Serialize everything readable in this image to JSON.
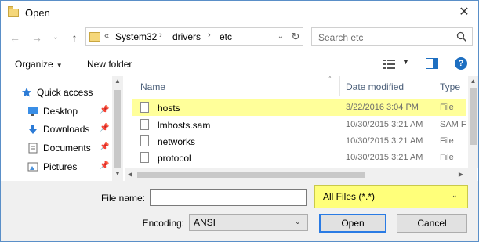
{
  "window": {
    "title": "Open",
    "close_glyph": "✕"
  },
  "nav": {
    "back_glyph": "←",
    "forward_glyph": "→",
    "recent_glyph": "⌄",
    "up_glyph": "↑",
    "breadcrumb_prefix": "«",
    "breadcrumbs": [
      "System32",
      "drivers",
      "etc"
    ],
    "crumb_sep": "›",
    "dropdown_glyph": "⌄",
    "refresh_glyph": "↻"
  },
  "search": {
    "placeholder": "Search etc"
  },
  "toolbar": {
    "organize_label": "Organize",
    "new_folder_label": "New folder",
    "arrow": "▼",
    "help_label": "?"
  },
  "sidebar": {
    "items": [
      {
        "label": "Quick access",
        "icon": "star-icon",
        "pinned": false
      },
      {
        "label": "Desktop",
        "icon": "desktop-icon",
        "pinned": true
      },
      {
        "label": "Downloads",
        "icon": "downloads-icon",
        "pinned": true
      },
      {
        "label": "Documents",
        "icon": "documents-icon",
        "pinned": true
      },
      {
        "label": "Pictures",
        "icon": "pictures-icon",
        "pinned": true
      }
    ],
    "pin_glyph": "📌"
  },
  "columns": {
    "name": "Name",
    "date": "Date modified",
    "type": "Type",
    "sort_glyph": "^"
  },
  "files": [
    {
      "name": "hosts",
      "date": "3/22/2016 3:04 PM",
      "type": "File",
      "highlighted": true
    },
    {
      "name": "lmhosts.sam",
      "date": "10/30/2015 3:21 AM",
      "type": "SAM F",
      "highlighted": false
    },
    {
      "name": "networks",
      "date": "10/30/2015 3:21 AM",
      "type": "File",
      "highlighted": false
    },
    {
      "name": "protocol",
      "date": "10/30/2015 3:21 AM",
      "type": "File",
      "highlighted": false
    }
  ],
  "scroll": {
    "up": "▲",
    "down": "▼",
    "left": "◀",
    "right": "▶"
  },
  "bottom": {
    "file_name_label": "File name:",
    "file_name_value": "",
    "file_type_value": "All Files  (*.*)",
    "encoding_label": "Encoding:",
    "encoding_value": "ANSI",
    "dd_glyph": "⌄",
    "open_label": "Open",
    "cancel_label": "Cancel"
  },
  "colors": {
    "highlight": "#ffff9a",
    "accent": "#1e6fc1"
  }
}
